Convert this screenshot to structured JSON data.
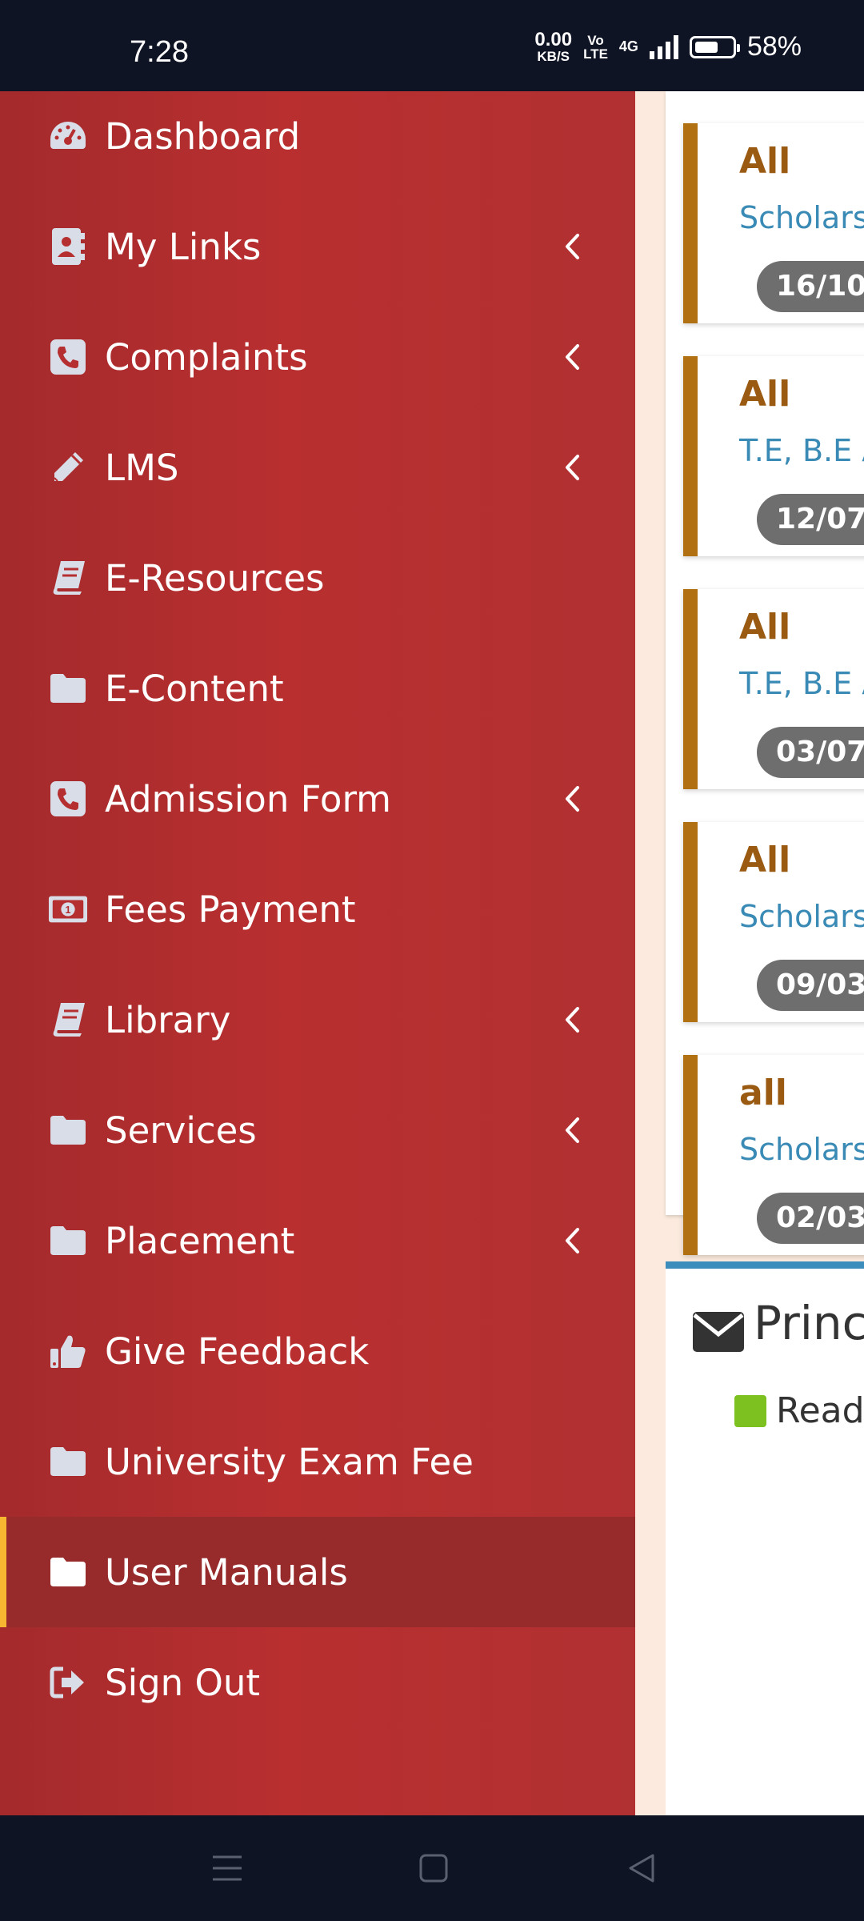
{
  "status_bar": {
    "time": "7:28",
    "net_speed_value": "0.00",
    "net_speed_unit": "KB/S",
    "volte_top": "Vo",
    "volte_bottom": "LTE",
    "network": "4G",
    "battery_percent": "58%",
    "battery_level": 0.58
  },
  "sidebar": {
    "items": [
      {
        "label": "Dashboard",
        "icon": "dashboard-icon"
      },
      {
        "label": "My Links",
        "icon": "address-book-icon"
      },
      {
        "label": "Complaints",
        "icon": "phone-icon"
      },
      {
        "label": "LMS",
        "icon": "pencil-icon"
      },
      {
        "label": "E-Resources",
        "icon": "book-icon"
      },
      {
        "label": "E-Content",
        "icon": "folder-icon"
      },
      {
        "label": "Admission Form",
        "icon": "phone-icon"
      },
      {
        "label": "Fees Payment",
        "icon": "money-icon"
      },
      {
        "label": "Library",
        "icon": "book-icon"
      },
      {
        "label": "Services",
        "icon": "folder-icon"
      },
      {
        "label": "Placement",
        "icon": "folder-icon"
      },
      {
        "label": "Give Feedback",
        "icon": "thumbs-up-icon"
      },
      {
        "label": "University Exam Fee",
        "icon": "folder-icon"
      },
      {
        "label": "User Manuals",
        "icon": "folder-open-icon",
        "active": true
      },
      {
        "label": "Sign Out",
        "icon": "sign-out-icon"
      }
    ],
    "accent_color": "#f7b731",
    "background_color": "#b52e30"
  },
  "notices": [
    {
      "title": "All",
      "subtitle": "Scholars",
      "date": "16/10/"
    },
    {
      "title": "All",
      "subtitle": "T.E, B.E A",
      "date": "12/07/"
    },
    {
      "title": "All",
      "subtitle": "T.E, B.E A",
      "date": "03/07/"
    },
    {
      "title": "All",
      "subtitle": "Scholars",
      "date": "09/03/"
    },
    {
      "title": "all",
      "subtitle": "Scholars",
      "date": "02/03/"
    }
  ],
  "principal_panel": {
    "title": "Princ",
    "legend_label": "Read",
    "legend_color": "#7cc11f",
    "header_color": "#3c8dbc"
  },
  "nav_bar": {
    "buttons": [
      "menu-icon",
      "home-icon",
      "back-icon"
    ]
  }
}
